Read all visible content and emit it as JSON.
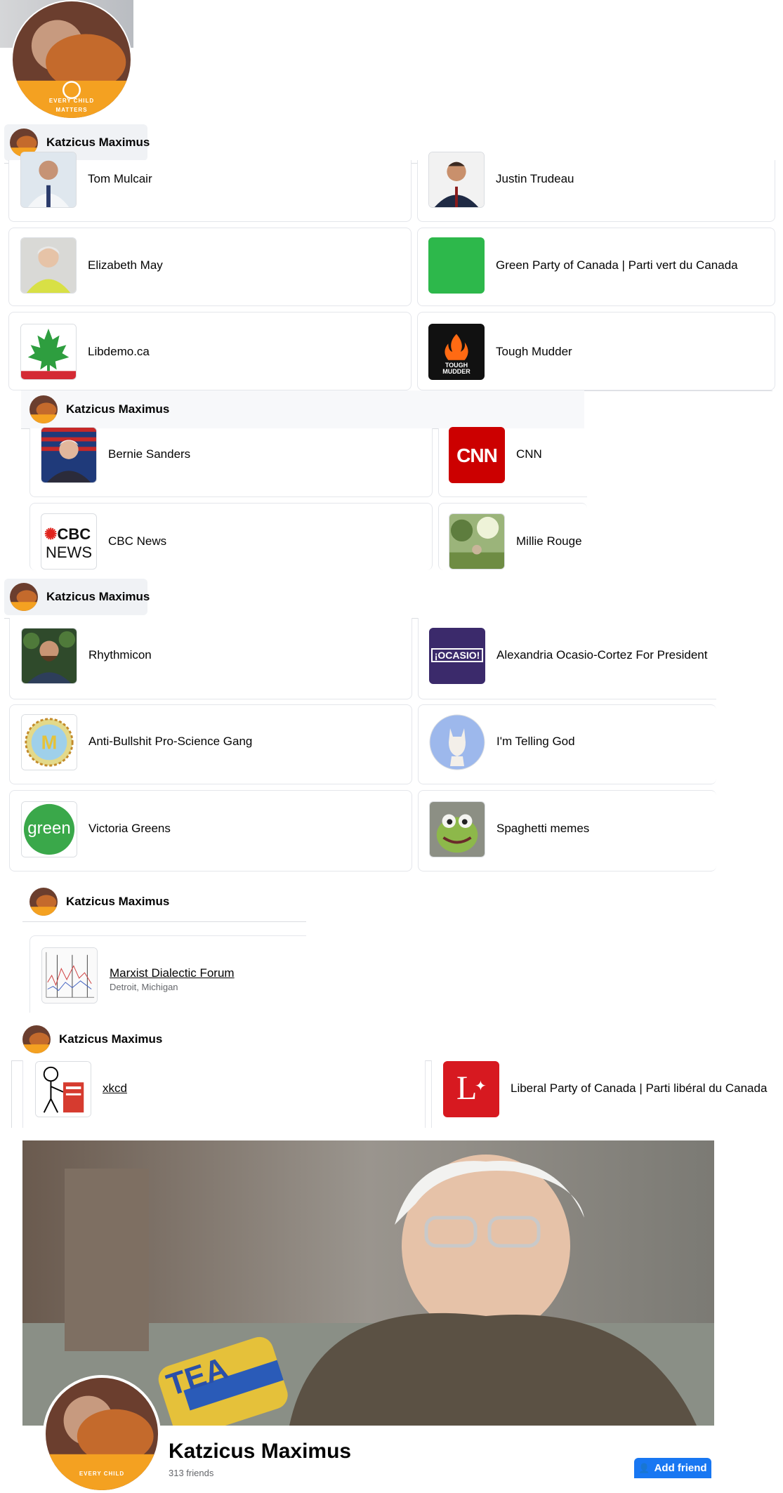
{
  "profile": {
    "name": "Katzicus Maximus",
    "friends": "313 friends",
    "add_friend_label": "Add friend",
    "badge_text_top": "EVERY CHILD",
    "badge_text_bottom": "MATTERS"
  },
  "sections": [
    {
      "header": "Katzicus Maximus",
      "items": [
        {
          "label": "Tom Mulcair",
          "icon": "person-photo"
        },
        {
          "label": "Justin Trudeau",
          "icon": "person-photo"
        },
        {
          "label": "Elizabeth May",
          "icon": "person-photo"
        },
        {
          "label": "Green Party of Canada | Parti vert du Canada",
          "icon": "green-square"
        },
        {
          "label": "Libdemo.ca",
          "icon": "maple-leaf-logo"
        },
        {
          "label": "Tough Mudder",
          "icon": "tough-mudder-logo",
          "logo_text": "TOUGH MUDDER"
        }
      ]
    },
    {
      "header": "Katzicus Maximus",
      "items": [
        {
          "label": "Bernie Sanders",
          "icon": "person-photo"
        },
        {
          "label": "CNN",
          "icon": "cnn-logo",
          "logo_text": "CNN"
        },
        {
          "label": "CBC News",
          "icon": "cbc-logo",
          "logo_text": "CBC",
          "logo_text2": "NEWS"
        },
        {
          "label": "Millie Rouge",
          "icon": "nature-photo"
        }
      ]
    },
    {
      "header": "Katzicus Maximus",
      "items": [
        {
          "label": "Rhythmicon",
          "icon": "person-photo"
        },
        {
          "label": "Alexandria Ocasio-Cortez For President",
          "icon": "aoc-logo",
          "logo_text": "¡OCASIO!"
        },
        {
          "label": "Anti-Bullshit Pro-Science Gang",
          "icon": "science-logo"
        },
        {
          "label": "I'm Telling God",
          "icon": "cat-photo"
        },
        {
          "label": "Victoria Greens",
          "icon": "green-logo",
          "logo_text": "green"
        },
        {
          "label": "Spaghetti memes",
          "icon": "kermit-photo"
        }
      ]
    },
    {
      "header": "Katzicus Maximus",
      "items": [
        {
          "label": "Marxist Dialectic Forum",
          "sub": "Detroit, Michigan",
          "icon": "chart-thumbnail"
        }
      ]
    },
    {
      "header": "Katzicus Maximus",
      "items": [
        {
          "label": "xkcd",
          "icon": "stick-figure-icon"
        },
        {
          "label": "Liberal Party of Canada | Parti libéral du Canada",
          "icon": "liberal-logo",
          "logo_text": "L"
        }
      ]
    }
  ],
  "cover": {
    "text": "TEA"
  },
  "colors": {
    "accent": "#1877f2",
    "green_party": "#2db84b",
    "cnn_red": "#cc0000",
    "liberal_red": "#d71920",
    "aoc_purple": "#3b2a6b"
  }
}
